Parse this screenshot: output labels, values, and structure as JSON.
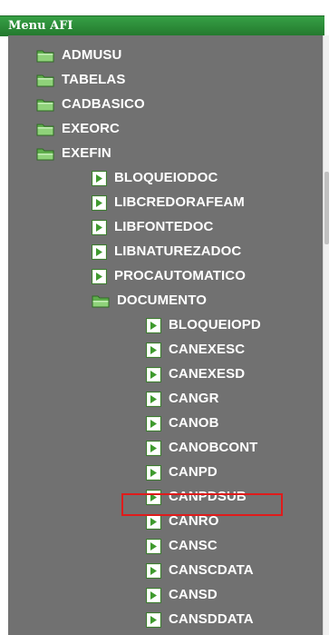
{
  "header": {
    "title": "Menu AFI",
    "color": "#2e8b3a"
  },
  "tree": {
    "panel_color": "#717171",
    "label_color": "#ffffff",
    "folder_icon": "folder-icon",
    "doc_icon": "document-arrow-icon",
    "nodes": [
      {
        "label": "ADMUSU",
        "level": 1,
        "icon": "folder-icon",
        "expanded": false
      },
      {
        "label": "TABELAS",
        "level": 1,
        "icon": "folder-icon",
        "expanded": false
      },
      {
        "label": "CADBASICO",
        "level": 1,
        "icon": "folder-icon",
        "expanded": false
      },
      {
        "label": "EXEORC",
        "level": 1,
        "icon": "folder-icon",
        "expanded": false
      },
      {
        "label": "EXEFIN",
        "level": 1,
        "icon": "folder-open-icon",
        "expanded": true
      },
      {
        "label": "BLOQUEIODOC",
        "level": 2,
        "icon": "document-arrow-icon"
      },
      {
        "label": "LIBCREDORAFEAM",
        "level": 2,
        "icon": "document-arrow-icon"
      },
      {
        "label": "LIBFONTEDOC",
        "level": 2,
        "icon": "document-arrow-icon"
      },
      {
        "label": "LIBNATUREZADOC",
        "level": 2,
        "icon": "document-arrow-icon"
      },
      {
        "label": "PROCAUTOMATICO",
        "level": 2,
        "icon": "document-arrow-icon"
      },
      {
        "label": "DOCUMENTO",
        "level": 2,
        "icon": "folder-open-icon",
        "expanded": true
      },
      {
        "label": "BLOQUEIOPD",
        "level": 3,
        "icon": "document-arrow-icon"
      },
      {
        "label": "CANEXESC",
        "level": 3,
        "icon": "document-arrow-icon"
      },
      {
        "label": "CANEXESD",
        "level": 3,
        "icon": "document-arrow-icon"
      },
      {
        "label": "CANGR",
        "level": 3,
        "icon": "document-arrow-icon"
      },
      {
        "label": "CANOB",
        "level": 3,
        "icon": "document-arrow-icon"
      },
      {
        "label": "CANOBCONT",
        "level": 3,
        "icon": "document-arrow-icon"
      },
      {
        "label": "CANPD",
        "level": 3,
        "icon": "document-arrow-icon"
      },
      {
        "label": "CANPDSUB",
        "level": 3,
        "icon": "document-arrow-icon",
        "highlighted": true
      },
      {
        "label": "CANRO",
        "level": 3,
        "icon": "document-arrow-icon"
      },
      {
        "label": "CANSC",
        "level": 3,
        "icon": "document-arrow-icon"
      },
      {
        "label": "CANSCDATA",
        "level": 3,
        "icon": "document-arrow-icon"
      },
      {
        "label": "CANSD",
        "level": 3,
        "icon": "document-arrow-icon"
      },
      {
        "label": "CANSDDATA",
        "level": 3,
        "icon": "document-arrow-icon"
      }
    ]
  },
  "highlight": {
    "target": "CANPDSUB",
    "color": "#e01b1b"
  }
}
